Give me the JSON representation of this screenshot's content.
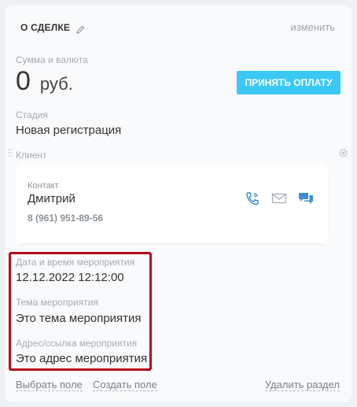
{
  "section": {
    "title": "О СДЕЛКЕ",
    "change_label": "изменить"
  },
  "amount": {
    "label": "Сумма и валюта",
    "value": "0",
    "currency": "руб.",
    "pay_button": "ПРИНЯТЬ ОПЛАТУ"
  },
  "stage": {
    "label": "Стадия",
    "value": "Новая регистрация"
  },
  "client": {
    "label": "Клиент",
    "contact_label": "Контакт",
    "contact_name": "Дмитрий",
    "contact_phone": "8 (961) 951-89-56"
  },
  "event": {
    "datetime_label": "Дата и время мероприятия",
    "datetime_value": "12.12.2022 12:12:00",
    "topic_label": "Тема мероприятия",
    "topic_value": "Это тема мероприятия",
    "address_label": "Адрес/ссылка мероприятия",
    "address_value": "Это адрес мероприятия"
  },
  "footer": {
    "select_field": "Выбрать поле",
    "create_field": "Создать поле",
    "delete_section": "Удалить раздел"
  },
  "colors": {
    "accent": "#3bc8f5",
    "highlight": "#b30c1b",
    "icon_blue": "#3b8fd6"
  },
  "icons": [
    "pencil-icon",
    "gear-icon",
    "drag-handle-icon",
    "phone-icon",
    "mail-icon",
    "chat-icon"
  ]
}
